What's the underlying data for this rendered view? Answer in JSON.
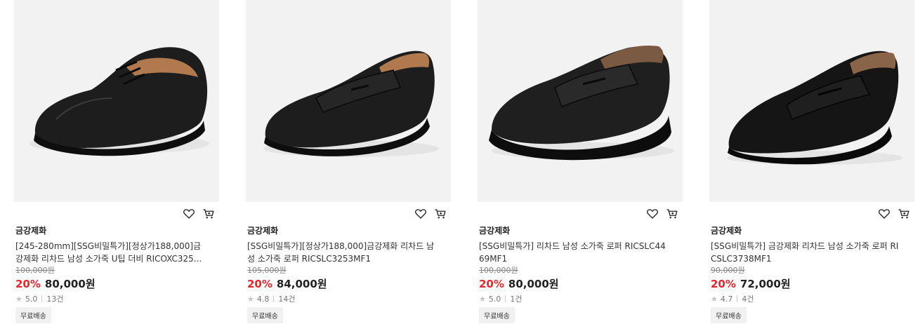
{
  "products": [
    {
      "brand": "금강제화",
      "title": "[245-280mm][SSG비밀특가][정상가188,000]금강제화 리차드 남성 소가죽 U팁 더비 RICOXC325...",
      "original_price": "100,000원",
      "discount": "20%",
      "price": "80,000원",
      "rating": "5.0",
      "reviews": "13건",
      "badge": "무료배송",
      "image_icon": "derby-shoe-image"
    },
    {
      "brand": "금강제화",
      "title": "[SSG비밀특가][정상가188,000]금강제화 리차드 남성 소가죽 로퍼 RICSLC3253MF1",
      "original_price": "105,000원",
      "discount": "20%",
      "price": "84,000원",
      "rating": "4.8",
      "reviews": "14건",
      "badge": "무료배송",
      "image_icon": "loafer-shoe-image"
    },
    {
      "brand": "금강제화",
      "title": "[SSG비밀특가] 리차드 남성 소가죽 로퍼 RICSLC4469MF1",
      "original_price": "100,000원",
      "discount": "20%",
      "price": "80,000원",
      "rating": "5.0",
      "reviews": "1건",
      "badge": "무료배송",
      "image_icon": "loafer-shoe-image"
    },
    {
      "brand": "금강제화",
      "title": "[SSG비밀특가] 금강제화 리차드 남성 소가죽 로퍼 RICSLC3738MF1",
      "original_price": "90,000원",
      "discount": "20%",
      "price": "72,000원",
      "rating": "4.7",
      "reviews": "4건",
      "badge": "무료배송",
      "image_icon": "loafer-shoe-image"
    }
  ],
  "icons": {
    "wishlist": "heart-icon",
    "cart": "cart-icon",
    "star": "star-icon"
  },
  "colors": {
    "discount": "#e8262a",
    "image_bg": "#f2f2f2",
    "shoe": "#1c1c1c"
  }
}
